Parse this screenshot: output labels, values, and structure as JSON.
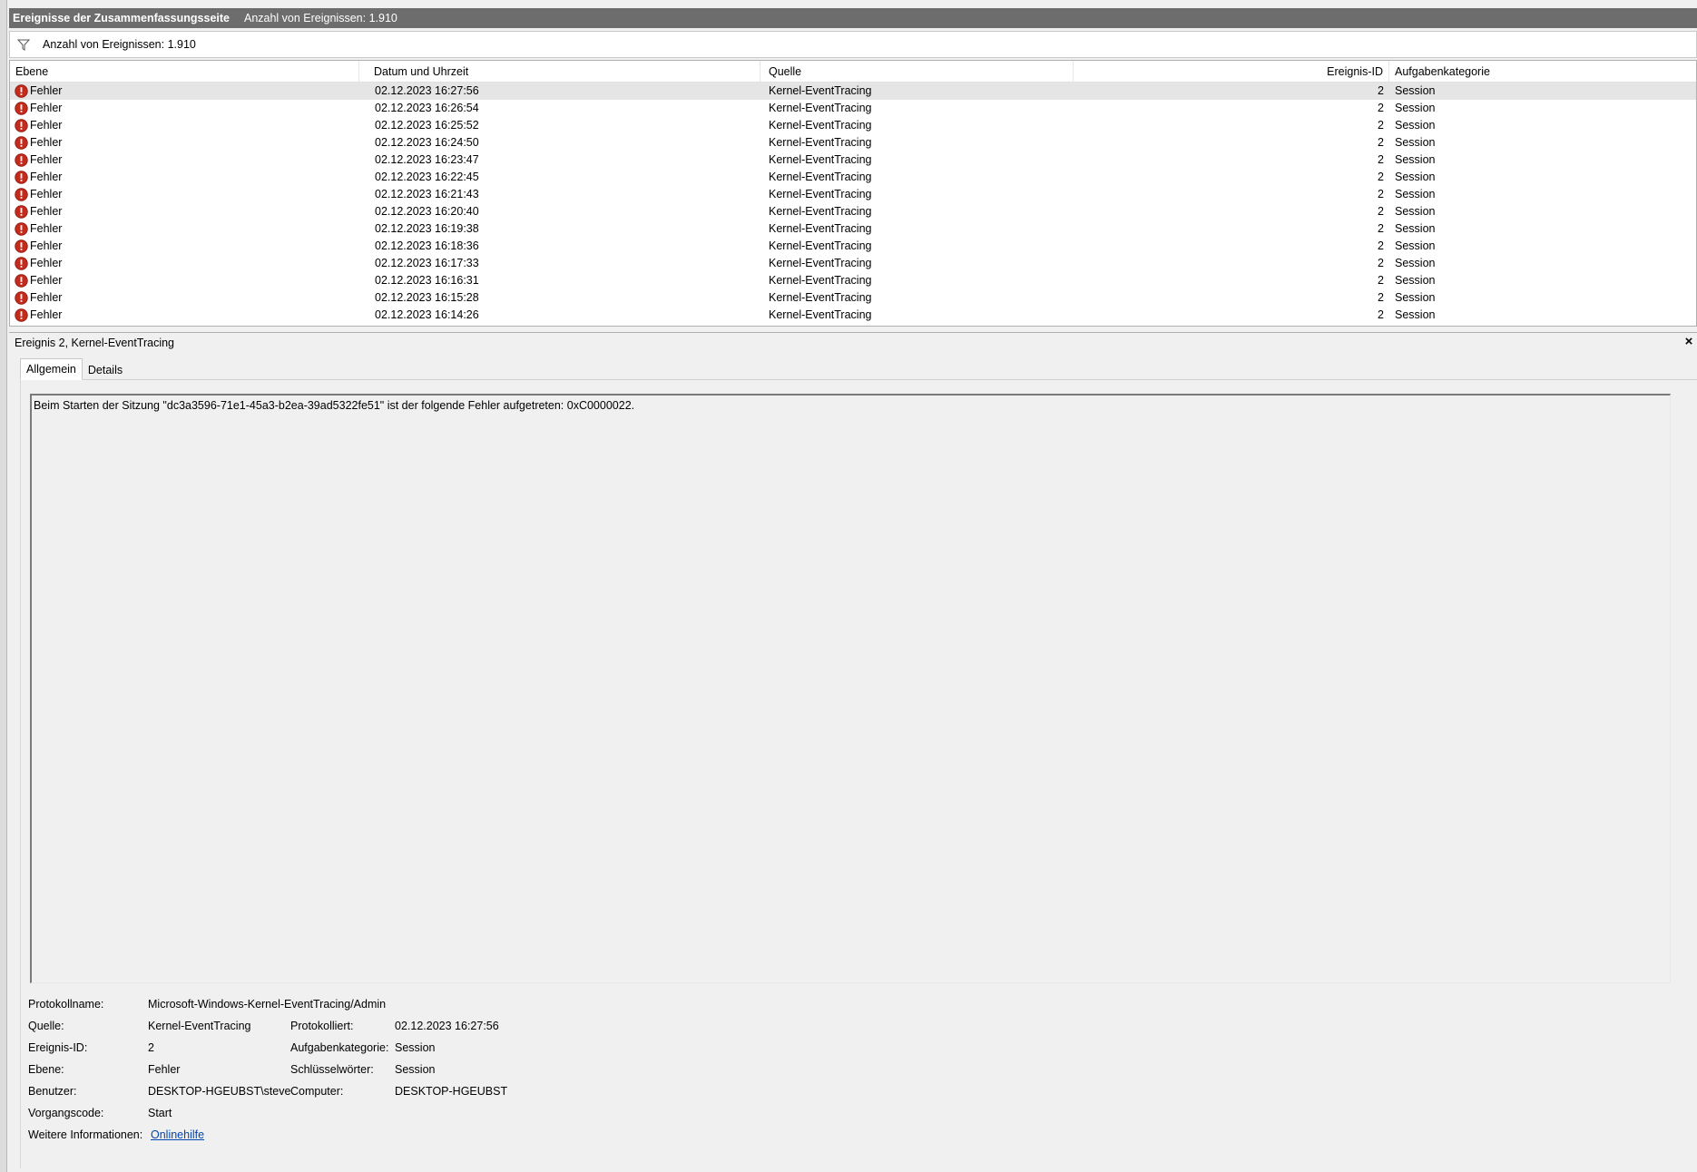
{
  "header": {
    "title": "Ereignisse der Zusammenfassungsseite",
    "count_text": "Anzahl von Ereignissen: 1.910"
  },
  "filter": {
    "icon": "filter-icon",
    "count_text": "Anzahl von Ereignissen: 1.910"
  },
  "columns": {
    "level": "Ebene",
    "datetime": "Datum und Uhrzeit",
    "source": "Quelle",
    "event_id": "Ereignis-ID",
    "category": "Aufgabenkategorie"
  },
  "rows": [
    {
      "level": "Fehler",
      "datetime": "02.12.2023 16:27:56",
      "source": "Kernel-EventTracing",
      "event_id": "2",
      "category": "Session"
    },
    {
      "level": "Fehler",
      "datetime": "02.12.2023 16:26:54",
      "source": "Kernel-EventTracing",
      "event_id": "2",
      "category": "Session"
    },
    {
      "level": "Fehler",
      "datetime": "02.12.2023 16:25:52",
      "source": "Kernel-EventTracing",
      "event_id": "2",
      "category": "Session"
    },
    {
      "level": "Fehler",
      "datetime": "02.12.2023 16:24:50",
      "source": "Kernel-EventTracing",
      "event_id": "2",
      "category": "Session"
    },
    {
      "level": "Fehler",
      "datetime": "02.12.2023 16:23:47",
      "source": "Kernel-EventTracing",
      "event_id": "2",
      "category": "Session"
    },
    {
      "level": "Fehler",
      "datetime": "02.12.2023 16:22:45",
      "source": "Kernel-EventTracing",
      "event_id": "2",
      "category": "Session"
    },
    {
      "level": "Fehler",
      "datetime": "02.12.2023 16:21:43",
      "source": "Kernel-EventTracing",
      "event_id": "2",
      "category": "Session"
    },
    {
      "level": "Fehler",
      "datetime": "02.12.2023 16:20:40",
      "source": "Kernel-EventTracing",
      "event_id": "2",
      "category": "Session"
    },
    {
      "level": "Fehler",
      "datetime": "02.12.2023 16:19:38",
      "source": "Kernel-EventTracing",
      "event_id": "2",
      "category": "Session"
    },
    {
      "level": "Fehler",
      "datetime": "02.12.2023 16:18:36",
      "source": "Kernel-EventTracing",
      "event_id": "2",
      "category": "Session"
    },
    {
      "level": "Fehler",
      "datetime": "02.12.2023 16:17:33",
      "source": "Kernel-EventTracing",
      "event_id": "2",
      "category": "Session"
    },
    {
      "level": "Fehler",
      "datetime": "02.12.2023 16:16:31",
      "source": "Kernel-EventTracing",
      "event_id": "2",
      "category": "Session"
    },
    {
      "level": "Fehler",
      "datetime": "02.12.2023 16:15:28",
      "source": "Kernel-EventTracing",
      "event_id": "2",
      "category": "Session"
    },
    {
      "level": "Fehler",
      "datetime": "02.12.2023 16:14:26",
      "source": "Kernel-EventTracing",
      "event_id": "2",
      "category": "Session"
    }
  ],
  "detail": {
    "title": "Ereignis 2, Kernel-EventTracing",
    "close_label": "×",
    "tabs": [
      "Allgemein",
      "Details"
    ],
    "message": "Beim Starten der Sitzung \"dc3a3596-71e1-45a3-b2ea-39ad5322fe51\" ist der folgende Fehler aufgetreten: 0xC0000022.",
    "props": {
      "log_name_label": "Protokollname:",
      "log_name": "Microsoft-Windows-Kernel-EventTracing/Admin",
      "source_label": "Quelle:",
      "source": "Kernel-EventTracing",
      "logged_label": "Protokolliert:",
      "logged": "02.12.2023 16:27:56",
      "event_id_label": "Ereignis-ID:",
      "event_id": "2",
      "category_label": "Aufgabenkategorie:",
      "category": "Session",
      "level_label": "Ebene:",
      "level": "Fehler",
      "keywords_label": "Schlüsselwörter:",
      "keywords": "Session",
      "user_label": "Benutzer:",
      "user": "DESKTOP-HGEUBST\\steve",
      "computer_label": "Computer:",
      "computer": "DESKTOP-HGEUBST",
      "opcode_label": "Vorgangscode:",
      "opcode": "Start",
      "more_info_label": "Weitere Informationen:",
      "more_info_link": "Onlinehilfe"
    }
  },
  "colors": {
    "titlebar": "#6d6d6d",
    "error_icon": "#c42b1c",
    "selected_row": "#e5e5e5",
    "link": "#0645ad"
  }
}
